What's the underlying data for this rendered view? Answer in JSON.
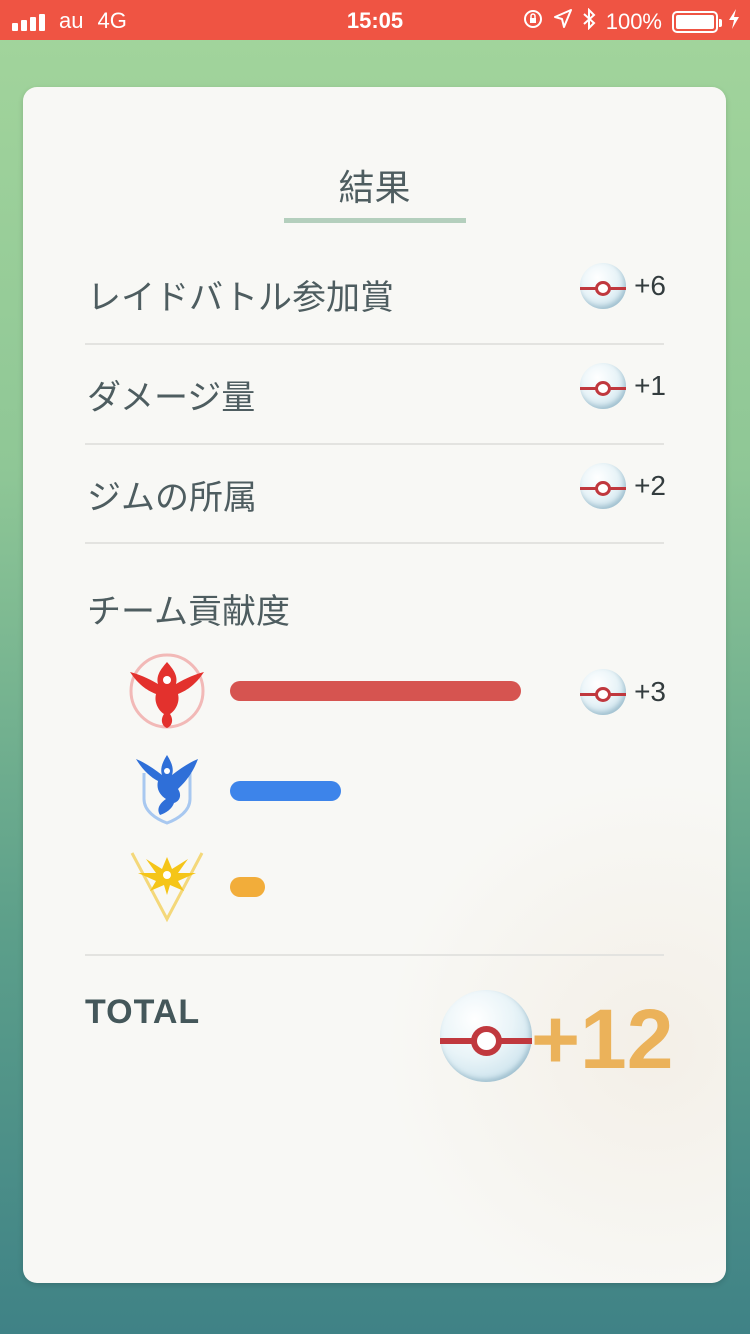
{
  "status_bar": {
    "carrier": "au",
    "network": "4G",
    "time": "15:05",
    "battery": "100%"
  },
  "title": "結果",
  "rows": [
    {
      "label": "レイドバトル参加賞",
      "reward": "+6"
    },
    {
      "label": "ダメージ量",
      "reward": "+1"
    },
    {
      "label": "ジムの所属",
      "reward": "+2"
    }
  ],
  "team_section": {
    "label": "チーム貢献度",
    "teams": [
      {
        "icon": "team-valor-icon",
        "color": "#d65450",
        "level": 0.5,
        "reward": "+3"
      },
      {
        "icon": "team-mystic-icon",
        "color": "#3d84ea",
        "level": 0.19
      },
      {
        "icon": "team-instinct-icon",
        "color": "#f2ad3a",
        "level": 0.06
      }
    ]
  },
  "total": {
    "label": "TOTAL",
    "value": "+12",
    "value_color": "#ebb25a"
  },
  "colors": {
    "status_bar": "#ef5443",
    "ball_band": "#c0383e"
  }
}
